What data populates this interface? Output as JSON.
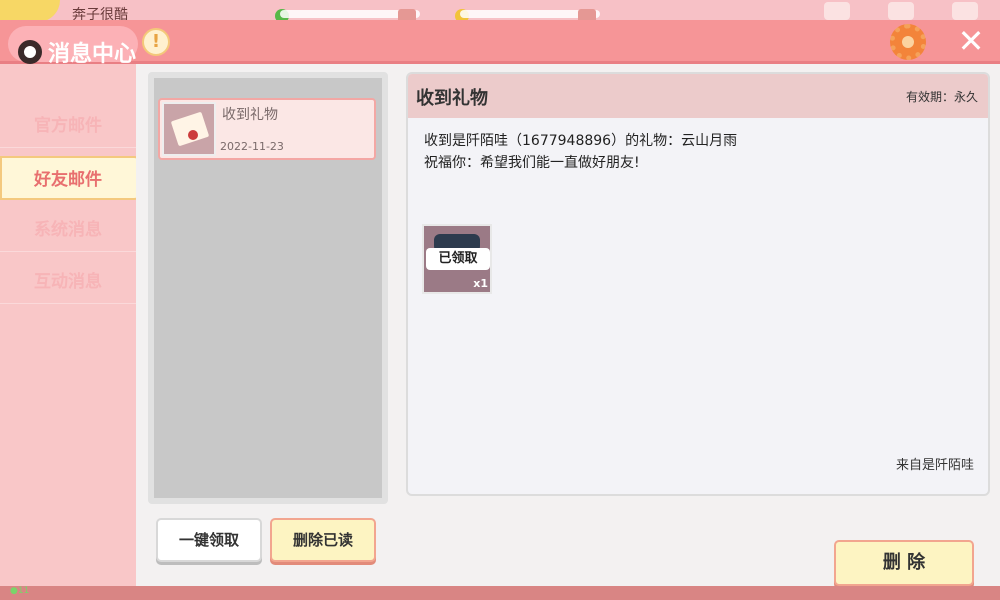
{
  "top": {
    "player_name": "奔子很酷"
  },
  "title": {
    "text": "消息中心",
    "info_symbol": "!"
  },
  "sidebar": {
    "items": [
      {
        "label": "官方邮件",
        "active": false
      },
      {
        "label": "好友邮件",
        "active": true
      },
      {
        "label": "系统消息",
        "active": false
      },
      {
        "label": "互动消息",
        "active": false
      }
    ]
  },
  "mail_list": [
    {
      "title": "收到礼物",
      "date": "2022-11-23"
    }
  ],
  "buttons": {
    "claim_all": "一键领取",
    "delete_read": "删除已读",
    "delete": "删 除",
    "close": "✕"
  },
  "detail": {
    "title": "收到礼物",
    "validity": "有效期：永久",
    "line1": "收到是阡陌哇（1677948896）的礼物：云山月雨",
    "line2": "祝福你：希望我们能一直做好朋友!",
    "item": {
      "status": "已领取",
      "quantity": "x1"
    },
    "sender": "来自是阡陌哇"
  },
  "footer": {
    "text": "●11"
  }
}
